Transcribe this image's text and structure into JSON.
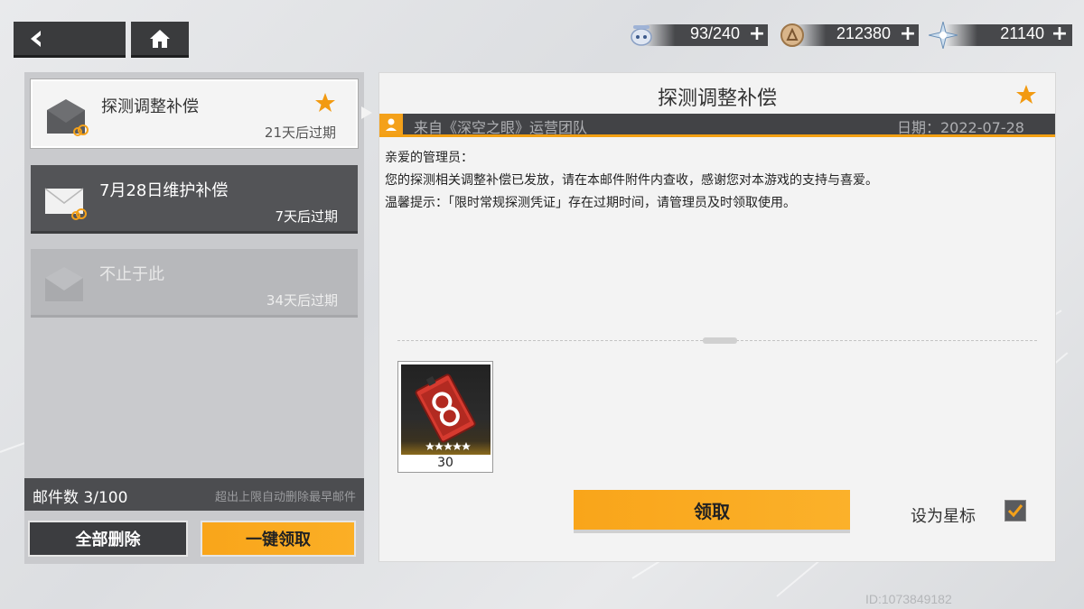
{
  "resources": [
    {
      "icon": "drone-icon",
      "value": "93/240"
    },
    {
      "icon": "coin-icon",
      "value": "212380"
    },
    {
      "icon": "crystal-icon",
      "value": "21140"
    }
  ],
  "mails": [
    {
      "title": "探测调整补偿",
      "expiry": "21天后过期",
      "starred": true,
      "state": "selected"
    },
    {
      "title": "7月28日维护补偿",
      "expiry": "7天后过期",
      "starred": false,
      "state": "unread"
    },
    {
      "title": "不止于此",
      "expiry": "34天后过期",
      "starred": false,
      "state": "read"
    }
  ],
  "mailbox": {
    "count": "邮件数 3/100",
    "limit_note": "超出上限自动删除最早邮件",
    "delete_all": "全部删除",
    "claim_all": "一键领取"
  },
  "detail": {
    "title": "探测调整补偿",
    "from": "来自《深空之眼》运营团队",
    "date": "日期：2022-07-28",
    "body": [
      "亲爱的管理员：",
      "您的探测相关调整补偿已发放，请在本邮件附件内查收，感谢您对本游戏的支持与喜爱。",
      "温馨提示：「限时常规探测凭证」存在过期时间，请管理员及时领取使用。"
    ],
    "attachment": {
      "quantity": "30",
      "rarity_stars": 5
    },
    "claim_label": "领取",
    "star_label": "设为星标",
    "star_checked": true
  },
  "uid": "ID:1073849182",
  "colors": {
    "accent": "#f9a51a",
    "dark": "#3a3b3d"
  }
}
